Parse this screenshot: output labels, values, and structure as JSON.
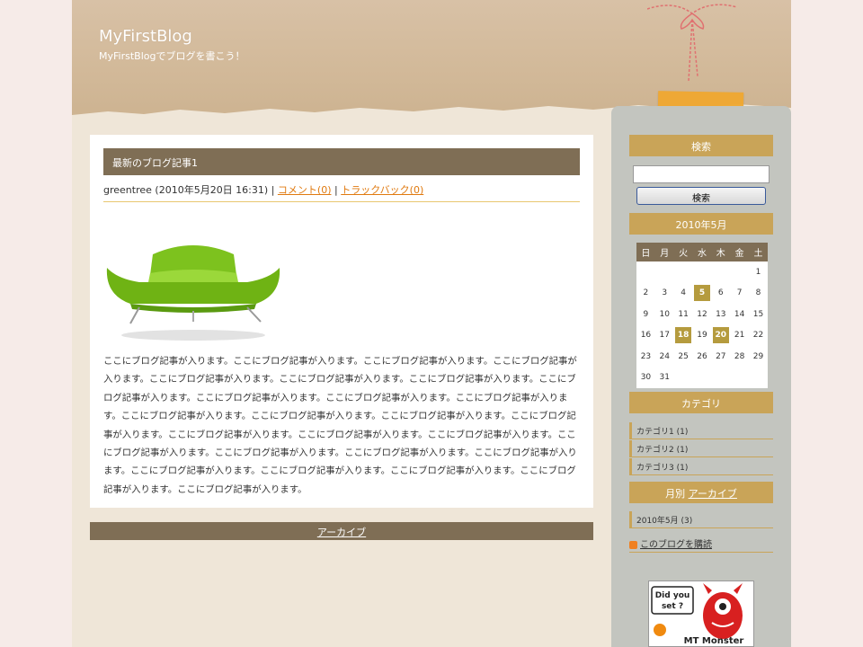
{
  "header": {
    "title": "MyFirstBlog",
    "description": "MyFirstBlogでブログを書こう！"
  },
  "entry": {
    "title": "最新のブログ記事1",
    "author": "greentree",
    "datetime": "(2010年5月20日 16:31)",
    "sep1": "|",
    "comments": "コメント(0)",
    "sep2": "|",
    "trackbacks": "トラックバック(0)",
    "body": "ここにブログ記事が入ります。ここにブログ記事が入ります。ここにブログ記事が入ります。ここにブログ記事が入ります。ここにブログ記事が入ります。ここにブログ記事が入ります。ここにブログ記事が入ります。ここにブログ記事が入ります。ここにブログ記事が入ります。ここにブログ記事が入ります。ここにブログ記事が入ります。ここにブログ記事が入ります。ここにブログ記事が入ります。ここにブログ記事が入ります。ここにブログ記事が入ります。ここにブログ記事が入ります。ここにブログ記事が入ります。ここにブログ記事が入ります。ここにブログ記事が入ります。ここにブログ記事が入ります。ここにブログ記事が入ります。ここにブログ記事が入ります。ここにブログ記事が入ります。ここにブログ記事が入ります。ここにブログ記事が入ります。ここにブログ記事が入ります。ここにブログ記事が入ります。"
  },
  "archive_link": "アーカイブ",
  "sidebar": {
    "search_title": "検索",
    "search_button": "検索",
    "calendar_title": "2010年5月",
    "weekdays": [
      "日",
      "月",
      "火",
      "水",
      "木",
      "金",
      "土"
    ],
    "weeks": [
      [
        "",
        "",
        "",
        "",
        "",
        "",
        "1"
      ],
      [
        "2",
        "3",
        "4",
        "5",
        "6",
        "7",
        "8"
      ],
      [
        "9",
        "10",
        "11",
        "12",
        "13",
        "14",
        "15"
      ],
      [
        "16",
        "17",
        "18",
        "19",
        "20",
        "21",
        "22"
      ],
      [
        "23",
        "24",
        "25",
        "26",
        "27",
        "28",
        "29"
      ],
      [
        "30",
        "31",
        "",
        "",
        "",
        "",
        ""
      ]
    ],
    "highlighted_days": [
      "5",
      "18",
      "20"
    ],
    "category_title": "カテゴリ",
    "categories": [
      "カテゴリ1 (1)",
      "カテゴリ2 (1)",
      "カテゴリ3 (1)"
    ],
    "monthly_prefix": "月別",
    "monthly_link": "アーカイブ",
    "monthly_items": [
      "2010年5月 (3)"
    ],
    "subscribe": "このブログを購読",
    "banner_text_1": "Did you",
    "banner_text_2": "set ?",
    "banner_text_3": "MT Monster"
  }
}
